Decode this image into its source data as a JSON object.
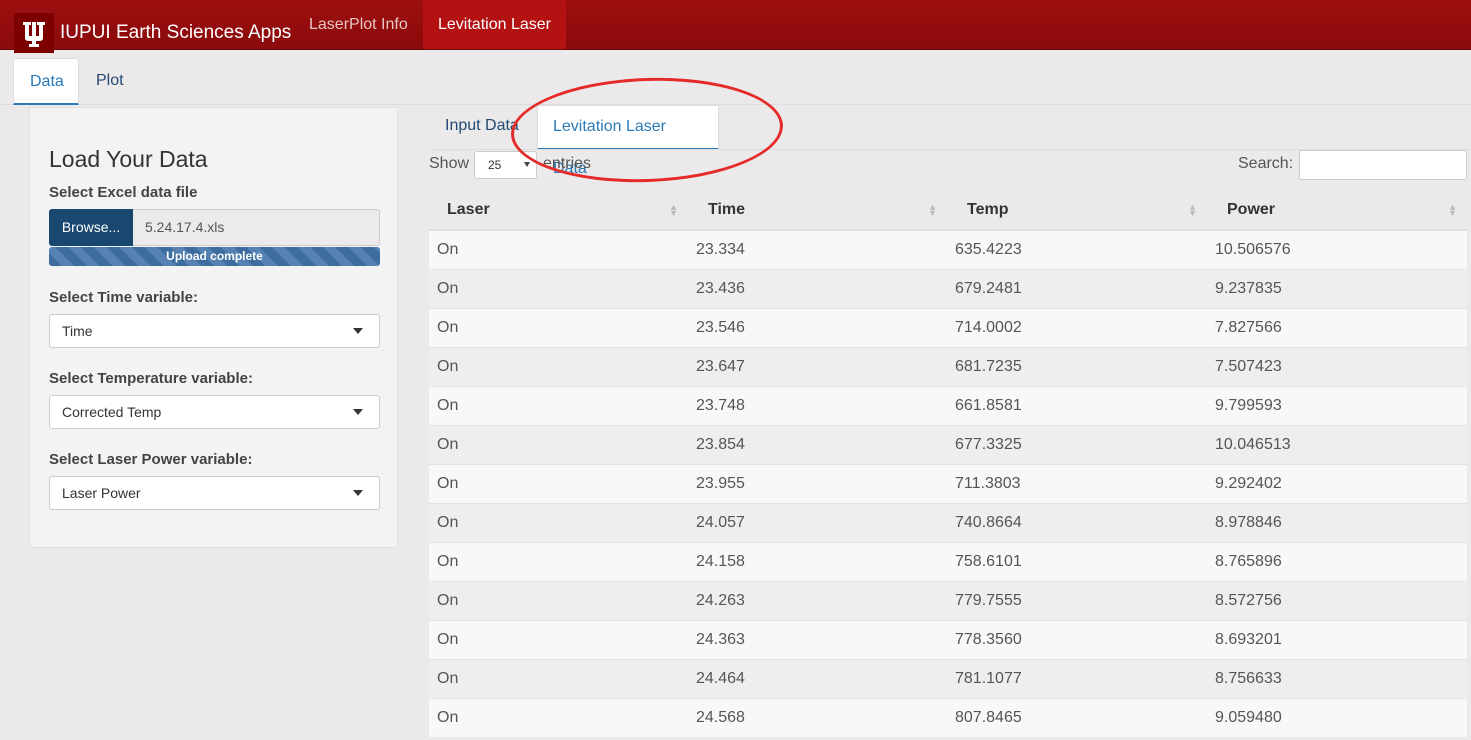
{
  "navbar": {
    "brand": "IUPUI Earth Sciences Apps",
    "logo_icon": "iu-trident-logo",
    "links": [
      "LaserPlot Info",
      "Levitation Laser"
    ],
    "active_link": "Levitation Laser"
  },
  "subtabs": {
    "items": [
      "Data",
      "Plot"
    ],
    "active": "Data"
  },
  "sidebar": {
    "title": "Load Your Data",
    "file_label": "Select Excel data file",
    "browse_label": "Browse...",
    "file_name": "5.24.17.4.xls",
    "upload_status": "Upload complete",
    "time_label": "Select Time variable:",
    "time_value": "Time",
    "temp_label": "Select Temperature variable:",
    "temp_value": "Corrected Temp",
    "power_label": "Select Laser Power variable:",
    "power_value": "Laser Power"
  },
  "inner_tabs": {
    "items": [
      "Input Data",
      "Levitation Laser Data"
    ],
    "active": "Levitation Laser Data"
  },
  "table_controls": {
    "show_label": "Show",
    "length_value": "25",
    "entries_label": "entries",
    "search_label": "Search:",
    "search_value": ""
  },
  "table": {
    "headers": [
      "Laser",
      "Time",
      "Temp",
      "Power"
    ],
    "rows": [
      [
        "On",
        "23.334",
        "635.4223",
        "10.506576"
      ],
      [
        "On",
        "23.436",
        "679.2481",
        "9.237835"
      ],
      [
        "On",
        "23.546",
        "714.0002",
        "7.827566"
      ],
      [
        "On",
        "23.647",
        "681.7235",
        "7.507423"
      ],
      [
        "On",
        "23.748",
        "661.8581",
        "9.799593"
      ],
      [
        "On",
        "23.854",
        "677.3325",
        "10.046513"
      ],
      [
        "On",
        "23.955",
        "711.3803",
        "9.292402"
      ],
      [
        "On",
        "24.057",
        "740.8664",
        "8.978846"
      ],
      [
        "On",
        "24.158",
        "758.6101",
        "8.765896"
      ],
      [
        "On",
        "24.263",
        "779.7555",
        "8.572756"
      ],
      [
        "On",
        "24.363",
        "778.3560",
        "8.693201"
      ],
      [
        "On",
        "24.464",
        "781.1077",
        "8.756633"
      ],
      [
        "On",
        "24.568",
        "807.8465",
        "9.059480"
      ]
    ]
  },
  "colors": {
    "navbar": "#9e0f10",
    "accent": "#2a7ab8",
    "annotation": "#e52a2a"
  }
}
